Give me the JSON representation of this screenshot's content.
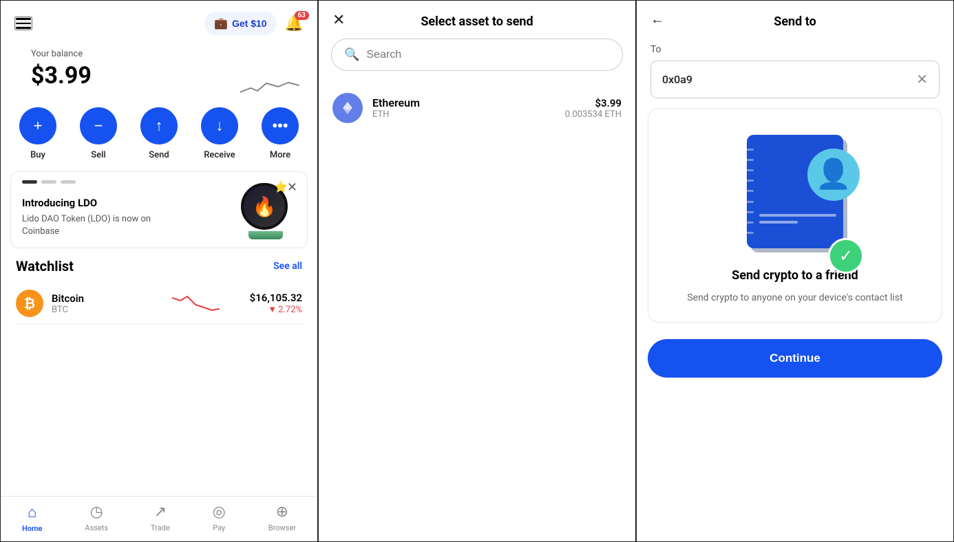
{
  "left": {
    "balance_label": "Your balance",
    "balance_amount": "$3.99",
    "get_money_label": "Get $10",
    "notification_count": "63",
    "actions": [
      {
        "label": "Buy",
        "icon": "+"
      },
      {
        "label": "Sell",
        "icon": "−"
      },
      {
        "label": "Send",
        "icon": "↑"
      },
      {
        "label": "Receive",
        "icon": "↓"
      },
      {
        "label": "More",
        "icon": "···"
      }
    ],
    "promo": {
      "title": "Introducing LDO",
      "body": "Lido DAO Token (LDO) is now on Coinbase"
    },
    "watchlist_title": "Watchlist",
    "see_all_label": "See all",
    "coins": [
      {
        "name": "Bitcoin",
        "ticker": "BTC",
        "price": "$16,105.32",
        "change": "▼ 2.72%",
        "negative": true
      }
    ],
    "nav": [
      {
        "label": "Home",
        "active": true
      },
      {
        "label": "Assets",
        "active": false
      },
      {
        "label": "Trade",
        "active": false
      },
      {
        "label": "Pay",
        "active": false
      },
      {
        "label": "Browser",
        "active": false
      }
    ]
  },
  "mid": {
    "title": "Select asset to send",
    "search_placeholder": "Search",
    "asset": {
      "name": "Ethereum",
      "ticker": "ETH",
      "usd_value": "$3.99",
      "crypto_value": "0.003534 ETH"
    }
  },
  "right": {
    "title": "Send to",
    "to_label": "To",
    "address_value": "0x0a9",
    "contact_title": "Send crypto to a friend",
    "contact_desc": "Send crypto to anyone on your device's contact list",
    "continue_label": "Continue"
  }
}
